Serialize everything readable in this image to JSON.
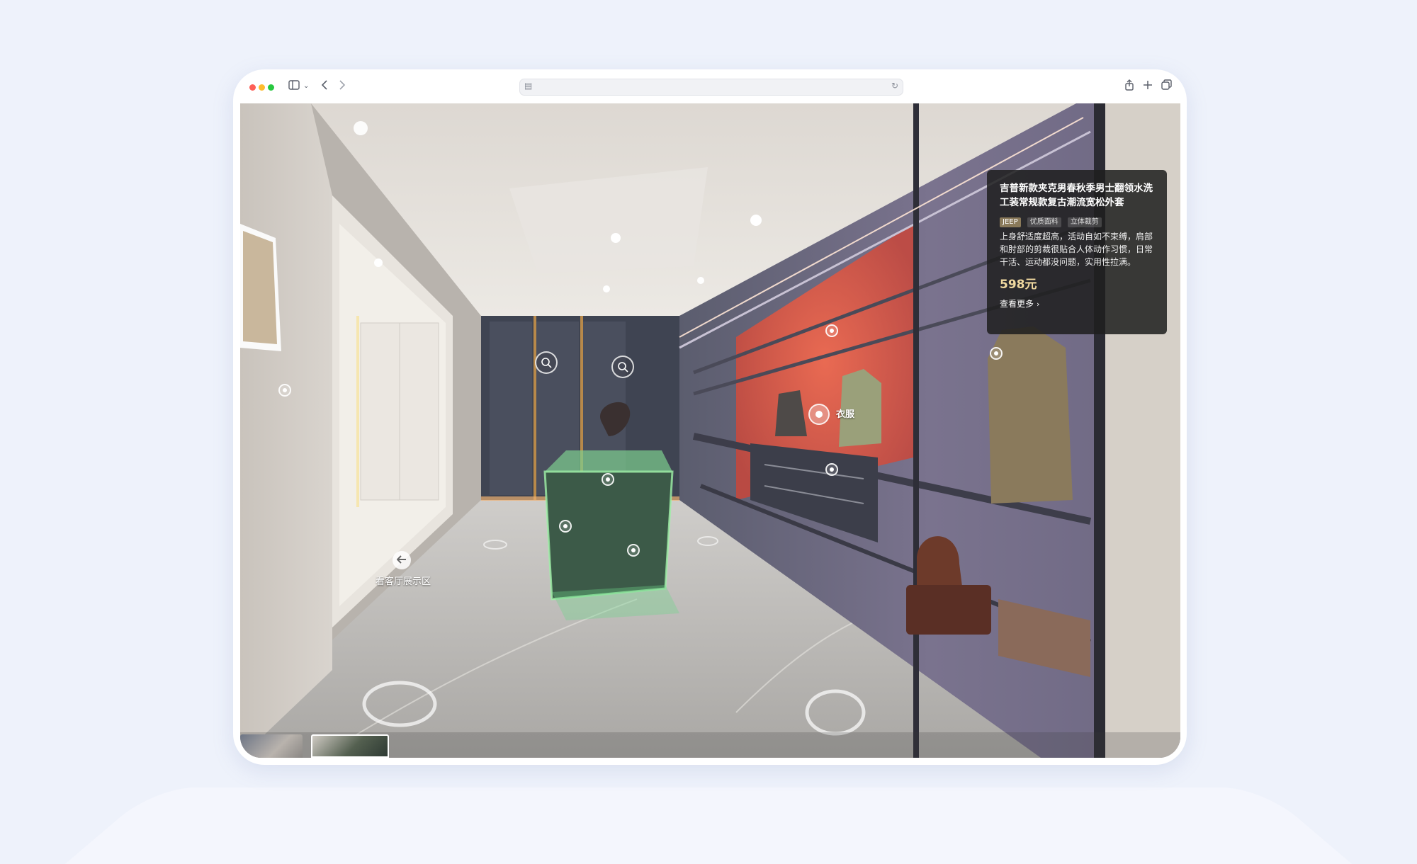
{
  "browser": {
    "url": "",
    "icons": {
      "sidebar": "sidebar-icon",
      "back": "chevron-left-icon",
      "forward": "chevron-right-icon",
      "share": "share-icon",
      "new_tab": "plus-icon",
      "tabs": "tabs-overview-icon",
      "reload": "reload-icon"
    }
  },
  "scene": {
    "nav_link_label": "看客厅展示区",
    "clothes_label": "衣服"
  },
  "product": {
    "title": "吉普新款夹克男春秋季男士翻领水洗工装常规款复古潮流宽松外套",
    "tags": [
      "JEEP",
      "优质面料",
      "立体裁剪"
    ],
    "description": "上身舒适度超高，活动自如不束缚，肩部和肘部的剪裁很贴合人体动作习惯，日常干活、运动都没问题，实用性拉满。",
    "price": "598元",
    "more_label": "查看更多"
  },
  "colors": {
    "accent_glow": "#ff6a4a",
    "cabinet_green": "#3c5a48",
    "price_gold": "#f0d9a0"
  }
}
